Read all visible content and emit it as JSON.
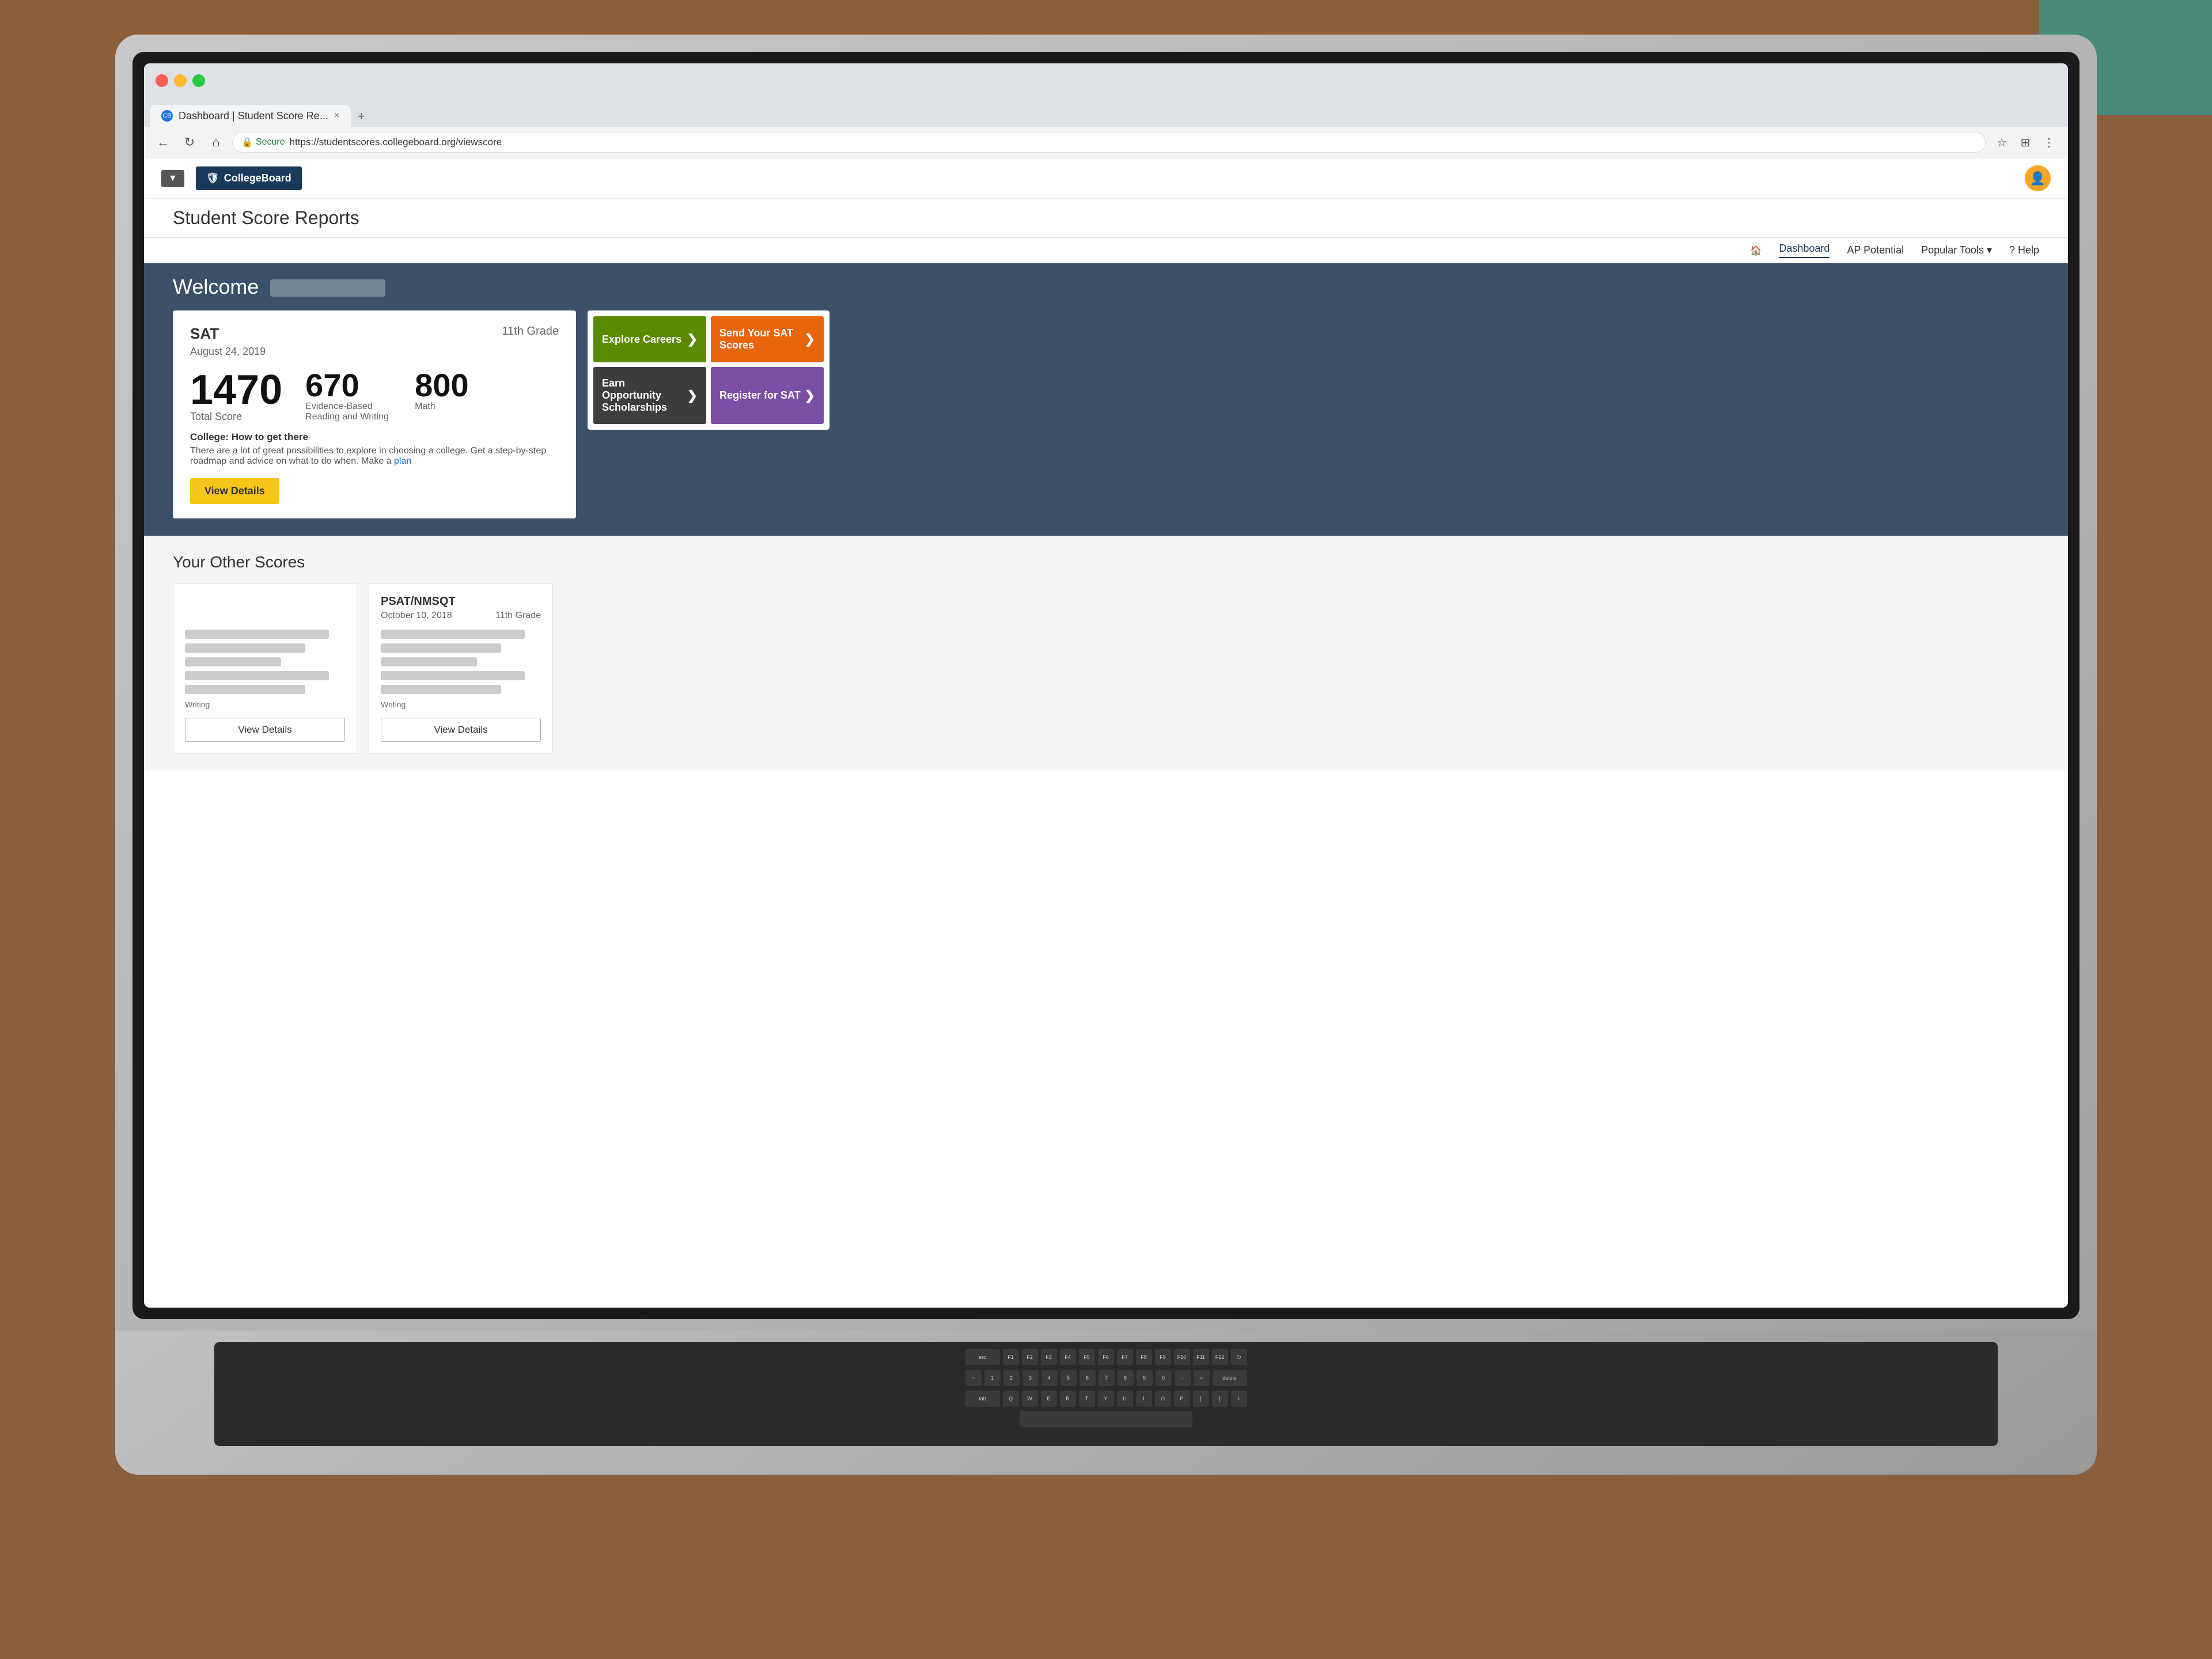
{
  "browser": {
    "tab_title": "Dashboard | Student Score Re...",
    "url_secure_label": "Secure",
    "url": "https://studentscores.collegeboard.org/viewscore",
    "tab_close": "×",
    "back_icon": "←",
    "refresh_icon": "↻",
    "home_icon": "⌂",
    "nav_buttons": [
      "←",
      "→",
      "↻",
      "⌂"
    ]
  },
  "collegeboard": {
    "logo_text": "CollegeBoard",
    "logo_shield": "🛡",
    "dropdown_label": "▼",
    "page_title": "Student Score Reports",
    "nav": {
      "dashboard_label": "Dashboard",
      "ap_potential_label": "AP Potential",
      "popular_tools_label": "Popular Tools",
      "popular_tools_arrow": "▾",
      "help_label": "? Help"
    },
    "user_icon": "👤"
  },
  "welcome": {
    "greeting": "Welcome"
  },
  "sat_card": {
    "title": "SAT",
    "date": "August 24, 2019",
    "grade": "11th Grade",
    "total_score": "1470",
    "total_score_label": "Total Score",
    "erw_score": "670",
    "erw_label": "Evidence-Based Reading and Writing",
    "math_score": "800",
    "math_label": "Math",
    "college_info_heading": "College: How to get there",
    "college_info_text": "There are a lot of great possibilities to explore in choosing a college. Get a step-by-step roadmap and advice on what to do when. Make a",
    "college_link_text": "plan",
    "view_details_label": "View Details"
  },
  "action_cards": [
    {
      "label": "Explore Careers",
      "color": "green",
      "arrow": "❯"
    },
    {
      "label": "Send Your SAT Scores",
      "color": "orange",
      "arrow": "❯"
    },
    {
      "label": "Earn Opportunity Scholarships",
      "color": "dark",
      "arrow": "❯"
    },
    {
      "label": "Register for SAT",
      "color": "purple",
      "arrow": "❯"
    }
  ],
  "other_scores": {
    "title": "Your Other Scores",
    "cards": [
      {
        "title": "",
        "date": "",
        "grade": "",
        "writing_label": "Writing",
        "view_details_label": "View Details"
      },
      {
        "title": "PSAT/NMSQT",
        "date": "October 10, 2018",
        "grade": "11th Grade",
        "writing_label": "Writing",
        "view_details_label": "View Details"
      }
    ]
  }
}
